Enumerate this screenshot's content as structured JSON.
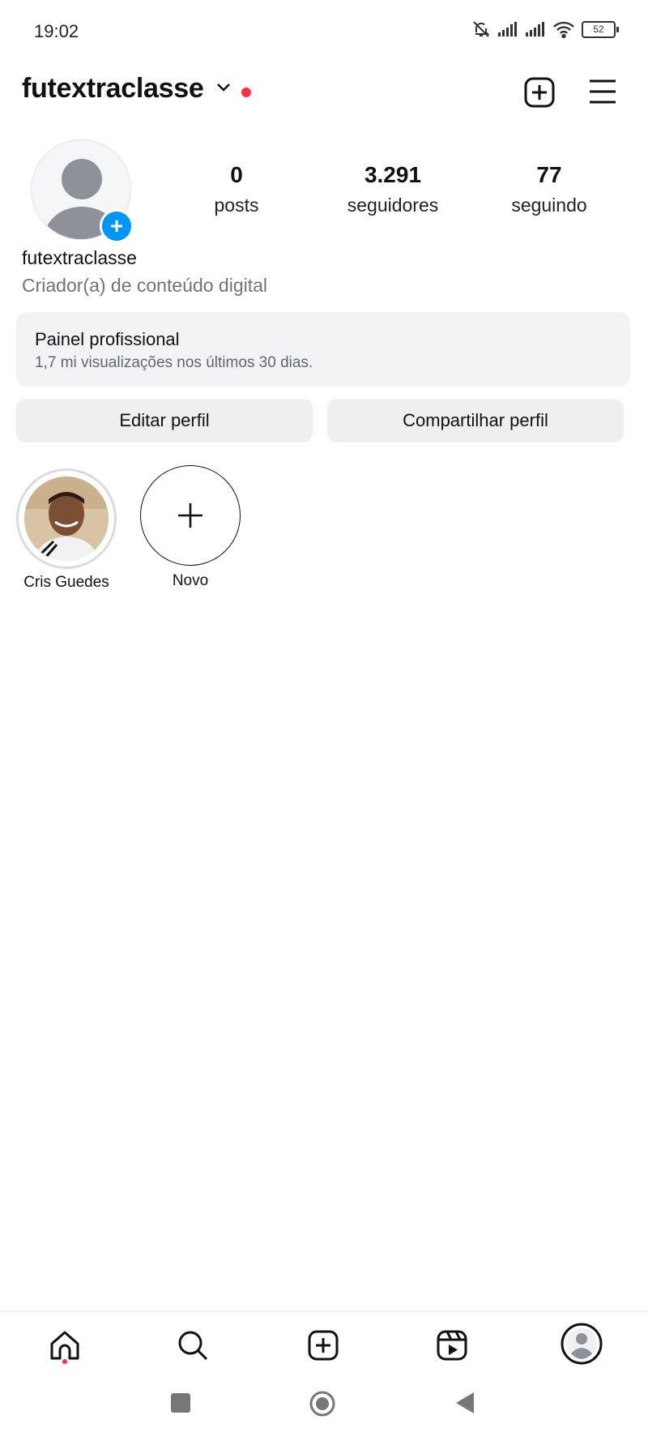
{
  "status_bar": {
    "time": "19:02",
    "battery": "52"
  },
  "header": {
    "username": "futextraclasse"
  },
  "profile": {
    "posts_count": "0",
    "posts_label": "posts",
    "followers_count": "3.291",
    "followers_label": "seguidores",
    "following_count": "77",
    "following_label": "seguindo",
    "name": "futextraclasse",
    "category": "Criador(a) de conteúdo digital"
  },
  "pro_panel": {
    "title": "Painel profissional",
    "subtitle": "1,7 mi visualizações nos últimos 30 dias."
  },
  "actions": {
    "edit_label": "Editar perfil",
    "share_label": "Compartilhar perfil"
  },
  "highlights": [
    {
      "label": "Cris Guedes"
    },
    {
      "label": "Novo"
    }
  ],
  "icons": {
    "status": [
      "mute-icon",
      "signal-icon",
      "signal-icon",
      "wifi-icon",
      "battery-icon"
    ],
    "header": [
      "chevron-down-icon",
      "notification-dot",
      "add-post-icon",
      "menu-icon"
    ],
    "nav": [
      "home-icon",
      "search-icon",
      "create-icon",
      "reels-icon",
      "profile-icon"
    ],
    "system": [
      "recents-icon",
      "home-circle-icon",
      "back-icon"
    ]
  },
  "colors": {
    "accent_blue": "#0095f6",
    "notification_red": "#ff3040",
    "panel_bg": "#f2f3f5",
    "button_bg": "#efefef"
  }
}
